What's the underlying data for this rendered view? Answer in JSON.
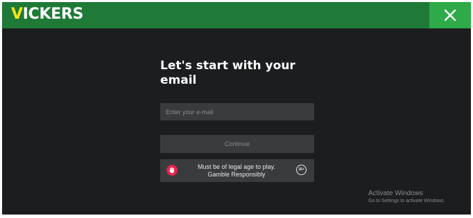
{
  "brand": {
    "logo_first_letter": "V",
    "logo_rest": "ICKERS",
    "accent_color": "#f5e21a",
    "header_color": "#1e7a36",
    "close_bg_color": "#2eaa48"
  },
  "header": {
    "close_icon": "close-icon"
  },
  "form": {
    "title": "Let's start with your email",
    "email_placeholder": "Enter your e-mail",
    "email_value": "",
    "continue_label": "Continue"
  },
  "notice": {
    "hand_icon": "stop-hand-icon",
    "hand_icon_color": "#e0254f",
    "line1": "Must be of legal age to play.",
    "line2": "Gamble Responsibly",
    "age_badge": "18+"
  },
  "os_watermark": {
    "title": "Activate Windows",
    "subtitle": "Go to Settings to activate Windows."
  }
}
